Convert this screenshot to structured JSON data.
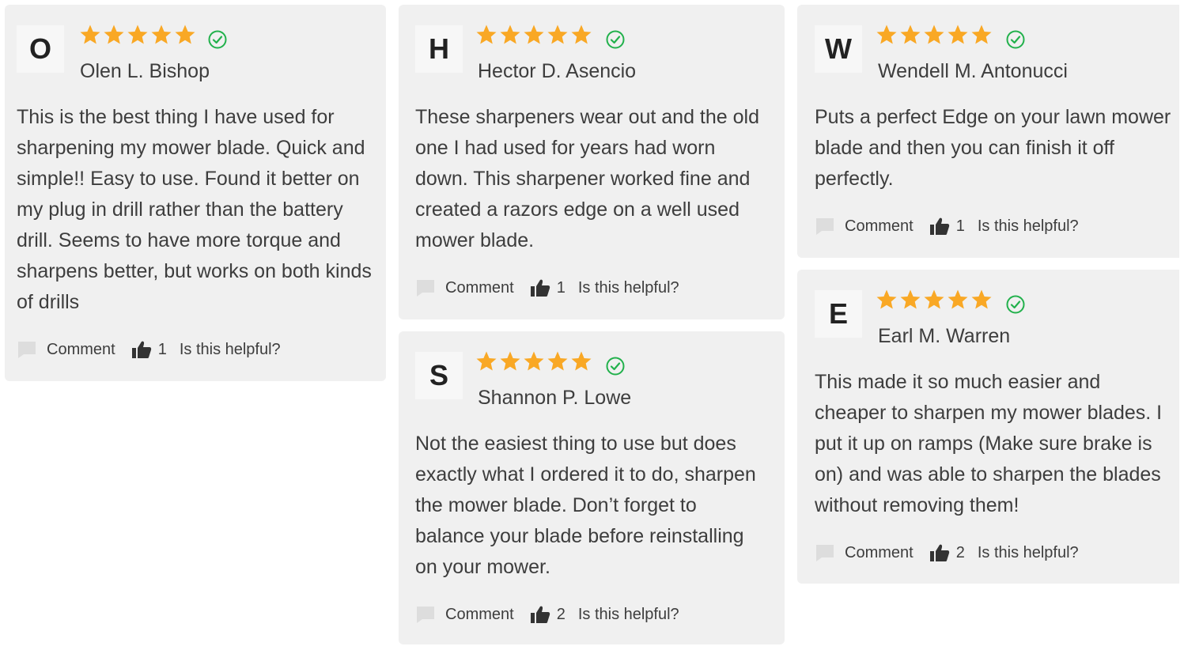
{
  "colors": {
    "star": "#f9a825",
    "verified": "#22b14c",
    "card_bg": "#f0f0f0",
    "icon": "#333333"
  },
  "reviews": [
    {
      "initial": "O",
      "name": "Olen L. Bishop",
      "rating": 5,
      "text": "This is the best thing I have used for sharpening my mower blade. Quick and simple!! Easy to use. Found it better on my plug in drill rather than the battery drill. Seems to have more torque and sharpens better, but works on both kinds of drills",
      "comment_label": "Comment",
      "helpful_count": "1",
      "helpful_label": "Is this helpful?"
    },
    {
      "initial": "H",
      "name": "Hector D. Asencio",
      "rating": 5,
      "text": "These sharpeners wear out and the old one I had used for years had worn down. This sharpener worked fine and created a razors edge on a well used mower blade.",
      "comment_label": "Comment",
      "helpful_count": "1",
      "helpful_label": "Is this helpful?"
    },
    {
      "initial": "S",
      "name": "Shannon P. Lowe",
      "rating": 5,
      "text": "Not the easiest thing to use but does exactly what I ordered it to do, sharpen the mower blade. Don’t forget to balance your blade before reinstalling on your mower.",
      "comment_label": "Comment",
      "helpful_count": "2",
      "helpful_label": "Is this helpful?"
    },
    {
      "initial": "W",
      "name": "Wendell M. Antonucci",
      "rating": 5,
      "text": "Puts a perfect Edge on your lawn mower blade and then you can finish it off perfectly.",
      "comment_label": "Comment",
      "helpful_count": "1",
      "helpful_label": "Is this helpful?"
    },
    {
      "initial": "E",
      "name": "Earl M. Warren",
      "rating": 5,
      "text": "This made it so much easier and cheaper to sharpen my mower blades. I put it up on ramps (Make sure brake is on) and was able to sharpen the blades without removing them!",
      "comment_label": "Comment",
      "helpful_count": "2",
      "helpful_label": "Is this helpful?"
    }
  ]
}
